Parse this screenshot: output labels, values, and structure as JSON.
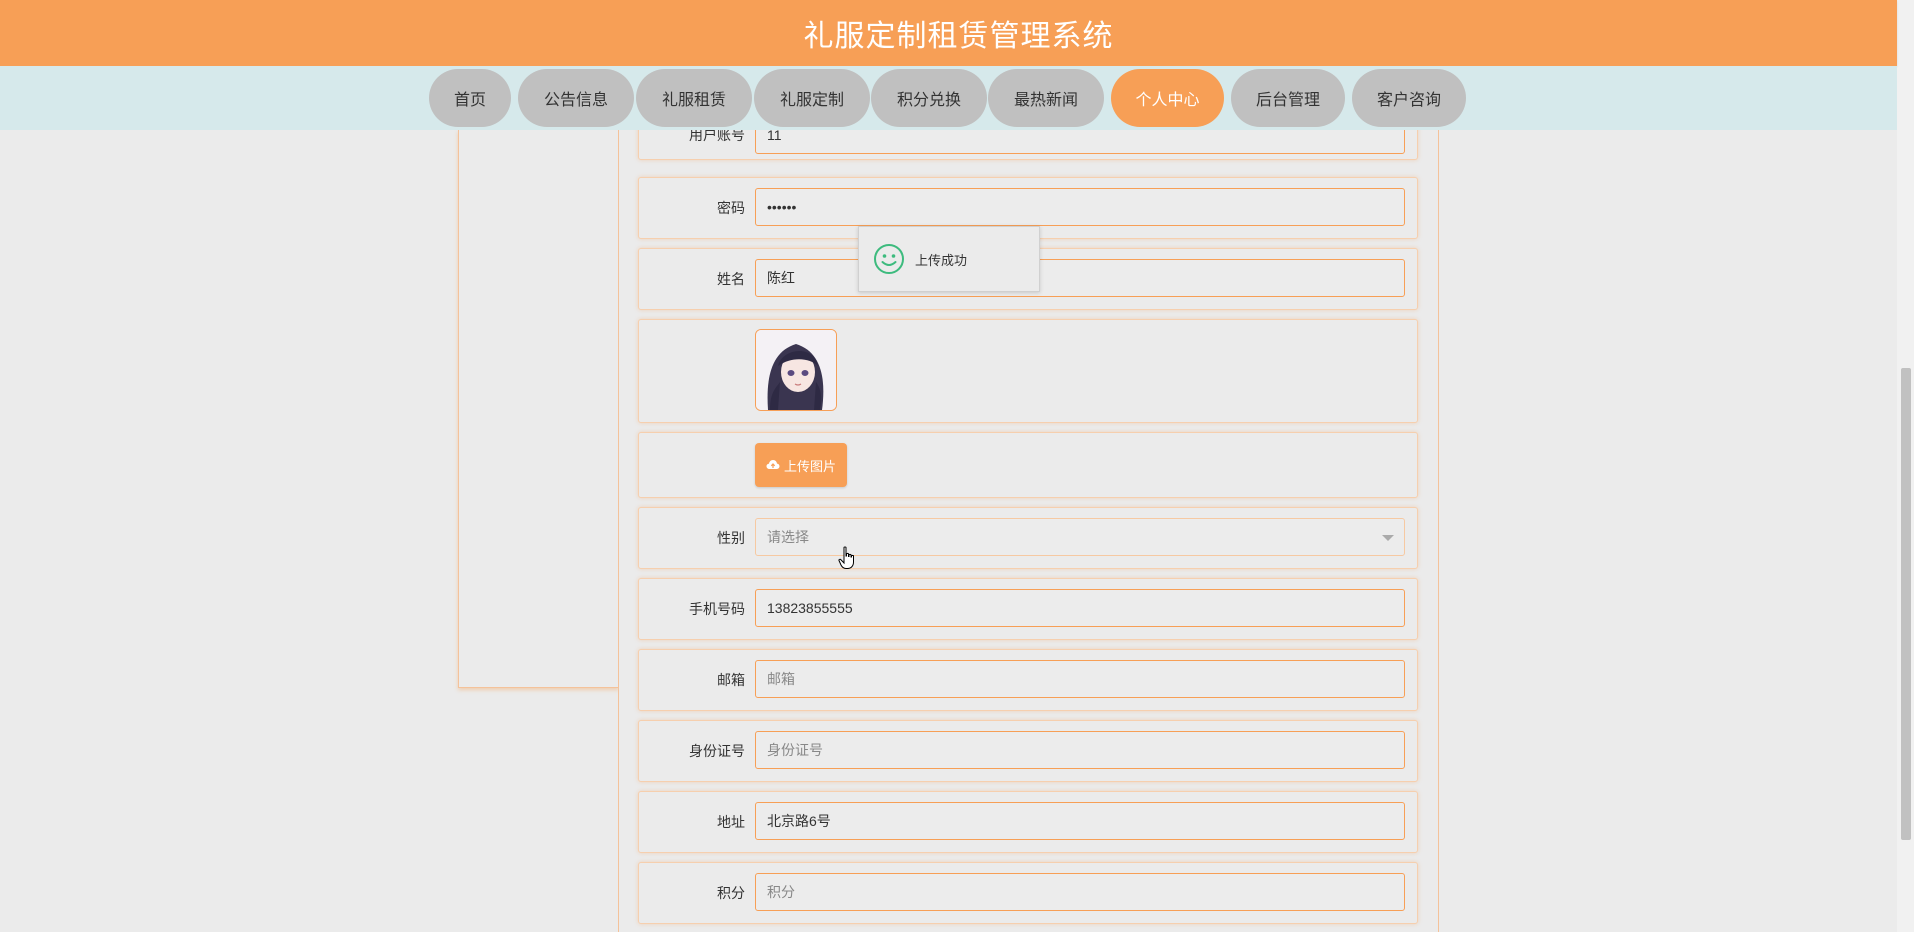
{
  "header": {
    "title": "礼服定制租赁管理系统"
  },
  "nav": {
    "items": [
      {
        "label": "首页"
      },
      {
        "label": "公告信息"
      },
      {
        "label": "礼服租赁"
      },
      {
        "label": "礼服定制"
      },
      {
        "label": "积分兑换"
      },
      {
        "label": "最热新闻"
      },
      {
        "label": "个人中心",
        "active": true
      },
      {
        "label": "后台管理"
      },
      {
        "label": "客户咨询"
      }
    ]
  },
  "form": {
    "account": {
      "label": "用户账号",
      "value": "11"
    },
    "password": {
      "label": "密码",
      "value": "••••••"
    },
    "name": {
      "label": "姓名",
      "value": "陈红"
    },
    "avatar": {
      "icon": "avatar-image"
    },
    "upload": {
      "label": "上传图片",
      "icon": "cloud-upload-icon"
    },
    "gender": {
      "label": "性别",
      "placeholder": "请选择"
    },
    "phone": {
      "label": "手机号码",
      "value": "13823855555"
    },
    "email": {
      "label": "邮箱",
      "placeholder": "邮箱"
    },
    "idcard": {
      "label": "身份证号",
      "placeholder": "身份证号"
    },
    "address": {
      "label": "地址",
      "value": "北京路6号"
    },
    "points": {
      "label": "积分",
      "placeholder": "积分"
    }
  },
  "toast": {
    "text": "上传成功",
    "icon": "smile-icon"
  },
  "colors": {
    "accent": "#f79f56",
    "nav_bg": "#d6e9eb",
    "page_bg": "#ebebeb",
    "nav_item_bg": "#c0c0c0"
  }
}
